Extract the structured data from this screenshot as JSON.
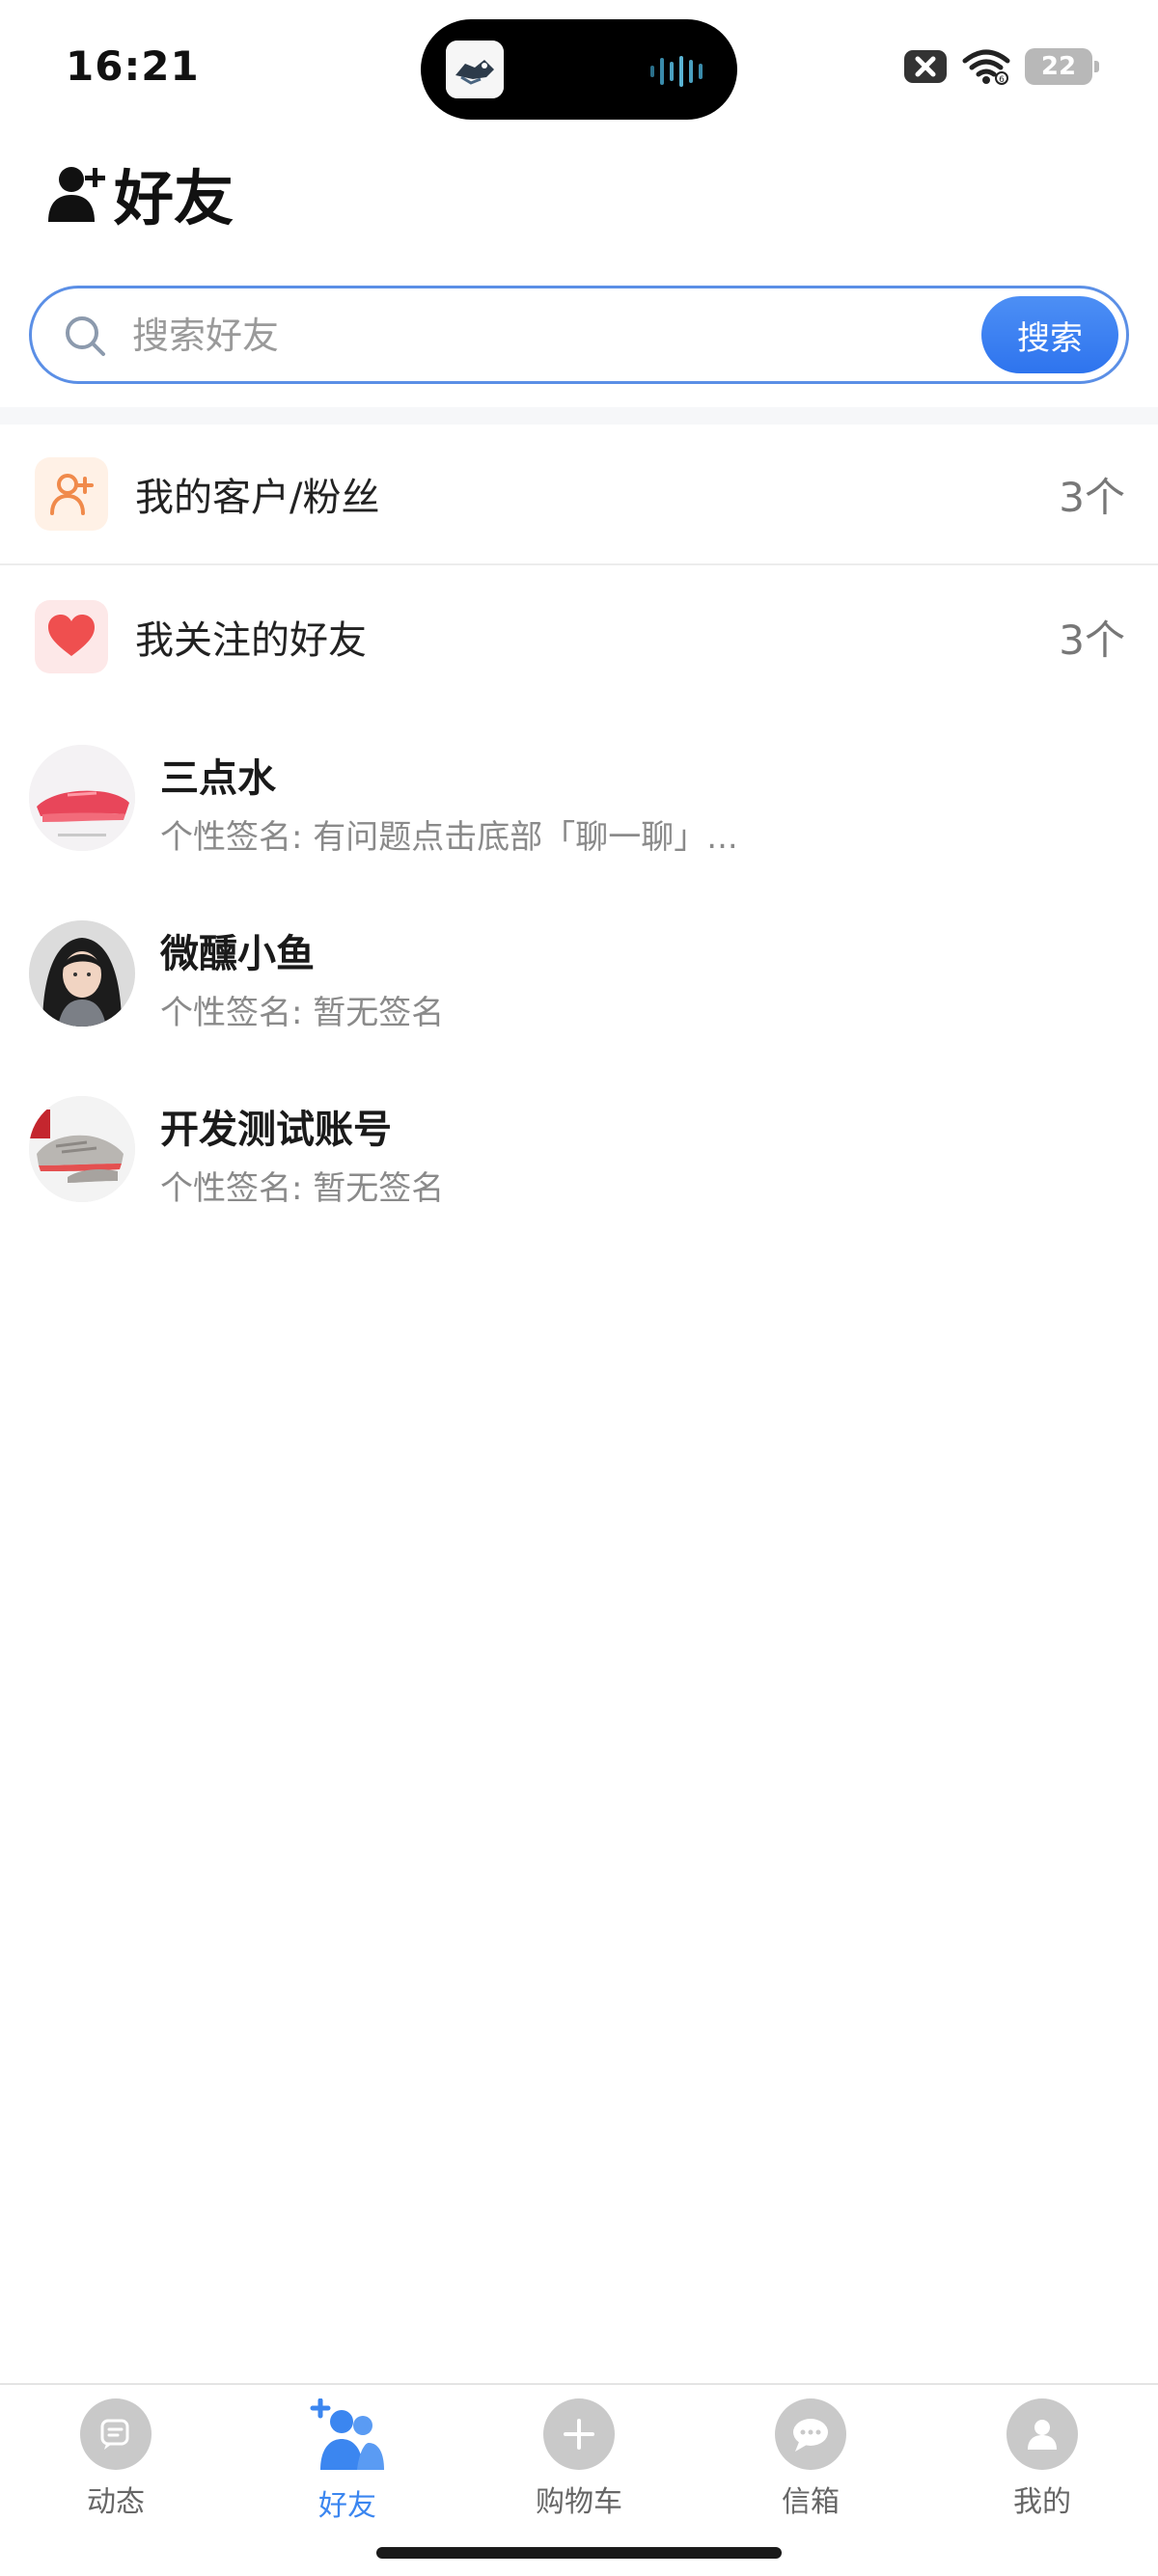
{
  "status_bar": {
    "time": "16:21",
    "battery": "22",
    "icons": [
      "notification-blocked-icon",
      "wifi-icon",
      "battery-icon"
    ]
  },
  "header": {
    "title": "好友",
    "icon": "add-user-icon"
  },
  "search": {
    "placeholder": "搜索好友",
    "value": "",
    "button_label": "搜索",
    "border_color": "#5b8fe6",
    "button_color": "#3b80f0"
  },
  "sections": [
    {
      "label": "我的客户/粉丝",
      "count": "3个",
      "icon": "add-person-icon",
      "icon_bg": "#fff1e6",
      "icon_color": "#f08a4b"
    },
    {
      "label": "我关注的好友",
      "count": "3个",
      "icon": "heart-icon",
      "icon_bg": "#fde8e8",
      "icon_color": "#ef4f4f"
    }
  ],
  "friends": [
    {
      "name": "三点水",
      "signature": "个性签名: 有问题点击底部「聊一聊」...",
      "avatar": "red-sneaker-avatar"
    },
    {
      "name": "微醺小鱼",
      "signature": "个性签名: 暂无签名",
      "avatar": "girl-photo-avatar"
    },
    {
      "name": "开发测试账号",
      "signature": "个性签名: 暂无签名",
      "avatar": "grey-sneakers-avatar"
    }
  ],
  "tabs": [
    {
      "label": "动态",
      "icon": "feed-icon",
      "active": false
    },
    {
      "label": "好友",
      "icon": "friends-icon",
      "active": true
    },
    {
      "label": "购物车",
      "icon": "plus-icon",
      "active": false
    },
    {
      "label": "信箱",
      "icon": "message-icon",
      "active": false
    },
    {
      "label": "我的",
      "icon": "profile-icon",
      "active": false
    }
  ],
  "colors": {
    "accent": "#3b86f0",
    "inactive_tab": "#c9c9c9"
  }
}
